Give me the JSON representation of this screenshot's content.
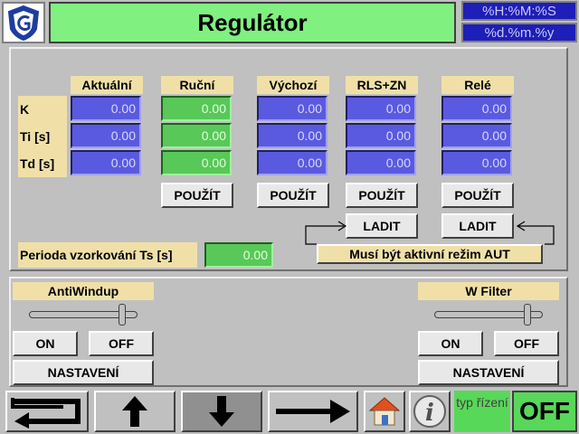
{
  "header": {
    "title": "Regulátor",
    "time_format": "%H:%M:%S",
    "date_format": "%d.%m.%y"
  },
  "params": {
    "row_labels": [
      "K",
      "Ti [s]",
      "Td [s]"
    ],
    "columns": [
      {
        "label": "Aktuální",
        "values": [
          "0.00",
          "0.00",
          "0.00"
        ]
      },
      {
        "label": "Ruční",
        "values": [
          "0.00",
          "0.00",
          "0.00"
        ]
      },
      {
        "label": "Výchozí",
        "values": [
          "0.00",
          "0.00",
          "0.00"
        ]
      },
      {
        "label": "RLS+ZN",
        "values": [
          "0.00",
          "0.00",
          "0.00"
        ]
      },
      {
        "label": "Relé",
        "values": [
          "0.00",
          "0.00",
          "0.00"
        ]
      }
    ],
    "apply_label": "POUŽÍT",
    "tune_label": "LADIT",
    "sampling_label": "Perioda vzorkování Ts [s]",
    "sampling_value": "0.00",
    "aut_note": "Musí být aktivní režim AUT"
  },
  "antiwindup": {
    "title": "AntiWindup",
    "on_label": "ON",
    "off_label": "OFF",
    "settings_label": "NASTAVENÍ"
  },
  "wfilter": {
    "title": "W Filter",
    "on_label": "ON",
    "off_label": "OFF",
    "settings_label": "NASTAVENÍ"
  },
  "footer": {
    "control_type_label": "typ řízení",
    "control_mode": "OFF"
  },
  "colors": {
    "title_bg": "#80f080",
    "cell_blue": "#5a5ae0",
    "cell_green": "#58c858",
    "label_bg": "#f0e0a8",
    "clock_bg": "#1e1eb8"
  },
  "icons": [
    "logo-icon",
    "return-arrow-icon",
    "arrow-up-icon",
    "arrow-down-icon",
    "arrow-right-icon",
    "home-icon",
    "info-icon"
  ]
}
